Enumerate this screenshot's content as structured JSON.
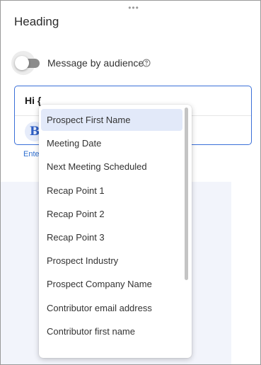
{
  "panel": {
    "heading": "Heading",
    "drag_handle": "•••",
    "toggle": {
      "label": "Message by audience",
      "on": false
    },
    "help_icon": "question-circle-icon"
  },
  "editor": {
    "text": "Hi {",
    "bold_button": "B",
    "helper_text": "Ente"
  },
  "dropdown": {
    "items": [
      "Prospect First Name",
      "Meeting Date",
      "Next Meeting Scheduled",
      "Recap Point 1",
      "Recap Point 2",
      "Recap Point 3",
      "Prospect Industry",
      "Prospect Company Name",
      "Contributor email address",
      "Contributor first name"
    ],
    "selected_index": 0
  },
  "colors": {
    "accent": "#3a6fd8",
    "selected_bg": "#e2e9f9",
    "toggle_off": "#8c8c8c"
  }
}
